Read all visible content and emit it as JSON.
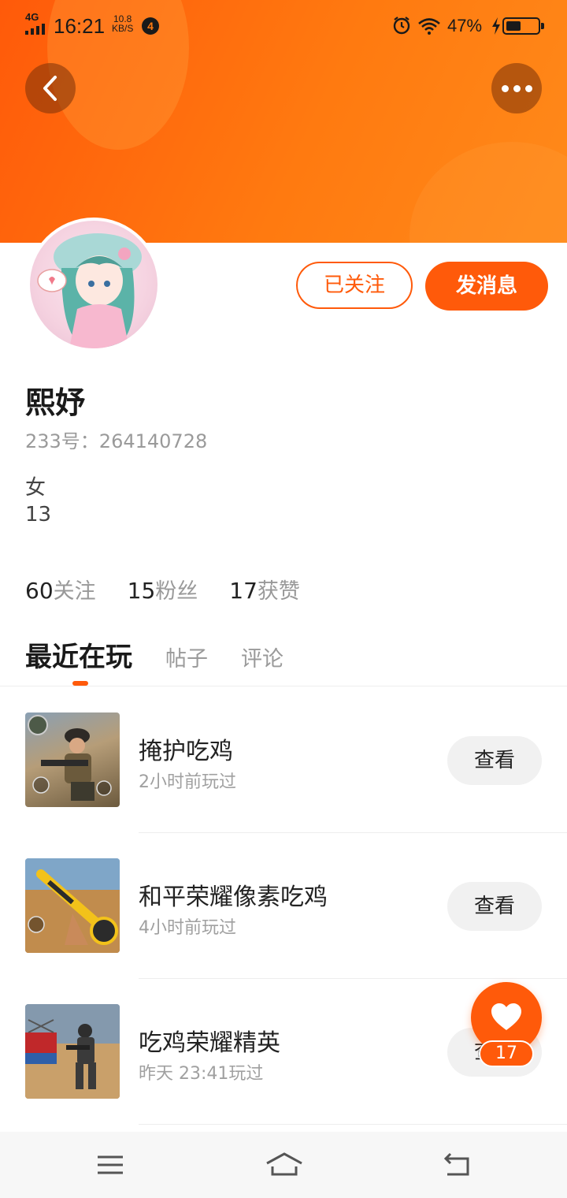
{
  "status_bar": {
    "network": "4G",
    "time": "16:21",
    "speed_value": "10.8",
    "speed_unit": "KB/S",
    "notification_count": "4",
    "battery_percent": "47%",
    "battery_level": 0.47
  },
  "header": {
    "back_icon": "chevron-left-icon",
    "more_icon": "more-dots-icon"
  },
  "profile": {
    "username": "熙妤",
    "user_id": "233号：264140728",
    "gender": "女",
    "age": "13",
    "follow_button": "已关注",
    "message_button": "发消息"
  },
  "stats": [
    {
      "num": "60",
      "label": "关注"
    },
    {
      "num": "15",
      "label": "粉丝"
    },
    {
      "num": "17",
      "label": "获赞"
    }
  ],
  "tabs": [
    {
      "label": "最近在玩",
      "active": true
    },
    {
      "label": "帖子",
      "active": false
    },
    {
      "label": "评论",
      "active": false
    }
  ],
  "games": [
    {
      "name": "掩护吃鸡",
      "time": "2小时前玩过",
      "button": "查看"
    },
    {
      "name": "和平荣耀像素吃鸡",
      "time": "4小时前玩过",
      "button": "查看"
    },
    {
      "name": "吃鸡荣耀精英",
      "time": "昨天 23:41玩过",
      "button": "查看"
    }
  ],
  "like_fab": {
    "icon": "heart-icon",
    "count": "17"
  },
  "colors": {
    "accent": "#ff5a0a",
    "banner_start": "#ff5a0a",
    "banner_end": "#ff8a1a"
  }
}
